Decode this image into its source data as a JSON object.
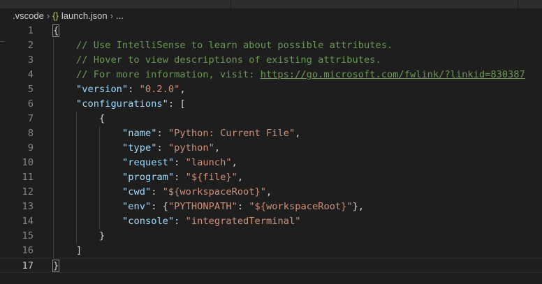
{
  "breadcrumb": {
    "folder": ".vscode",
    "file": "launch.json",
    "more": "...",
    "file_icon": "{}"
  },
  "editor": {
    "current_line": 17,
    "lines": [
      {
        "n": "1",
        "indent": 0,
        "tokens": [
          [
            "p",
            "{"
          ]
        ]
      },
      {
        "n": "2",
        "indent": 1,
        "tokens": [
          [
            "c",
            "// Use IntelliSense to learn about possible attributes."
          ]
        ]
      },
      {
        "n": "3",
        "indent": 1,
        "tokens": [
          [
            "c",
            "// Hover to view descriptions of existing attributes."
          ]
        ]
      },
      {
        "n": "4",
        "indent": 1,
        "tokens": [
          [
            "c",
            "// For more information, visit: "
          ],
          [
            "u",
            "https://go.microsoft.com/fwlink/?linkid=830387"
          ]
        ]
      },
      {
        "n": "5",
        "indent": 1,
        "tokens": [
          [
            "k",
            "\"version\""
          ],
          [
            "p",
            ": "
          ],
          [
            "s",
            "\"0.2.0\""
          ],
          [
            "p",
            ","
          ]
        ]
      },
      {
        "n": "6",
        "indent": 1,
        "tokens": [
          [
            "k",
            "\"configurations\""
          ],
          [
            "p",
            ": ["
          ]
        ]
      },
      {
        "n": "7",
        "indent": 2,
        "tokens": [
          [
            "p",
            "{"
          ]
        ]
      },
      {
        "n": "8",
        "indent": 3,
        "tokens": [
          [
            "k",
            "\"name\""
          ],
          [
            "p",
            ": "
          ],
          [
            "s",
            "\"Python: Current File\""
          ],
          [
            "p",
            ","
          ]
        ]
      },
      {
        "n": "9",
        "indent": 3,
        "tokens": [
          [
            "k",
            "\"type\""
          ],
          [
            "p",
            ": "
          ],
          [
            "s",
            "\"python\""
          ],
          [
            "p",
            ","
          ]
        ]
      },
      {
        "n": "10",
        "indent": 3,
        "tokens": [
          [
            "k",
            "\"request\""
          ],
          [
            "p",
            ": "
          ],
          [
            "s",
            "\"launch\""
          ],
          [
            "p",
            ","
          ]
        ]
      },
      {
        "n": "11",
        "indent": 3,
        "tokens": [
          [
            "k",
            "\"program\""
          ],
          [
            "p",
            ": "
          ],
          [
            "s",
            "\"${file}\""
          ],
          [
            "p",
            ","
          ]
        ]
      },
      {
        "n": "12",
        "indent": 3,
        "tokens": [
          [
            "k",
            "\"cwd\""
          ],
          [
            "p",
            ": "
          ],
          [
            "s",
            "\"${workspaceRoot}\""
          ],
          [
            "p",
            ","
          ]
        ]
      },
      {
        "n": "13",
        "indent": 3,
        "tokens": [
          [
            "k",
            "\"env\""
          ],
          [
            "p",
            ": {"
          ],
          [
            "s",
            "\"PYTHONPATH\""
          ],
          [
            "p",
            ": "
          ],
          [
            "s",
            "\"${workspaceRoot}\""
          ],
          [
            "p",
            "},"
          ]
        ]
      },
      {
        "n": "14",
        "indent": 3,
        "tokens": [
          [
            "k",
            "\"console\""
          ],
          [
            "p",
            ": "
          ],
          [
            "s",
            "\"integratedTerminal\""
          ]
        ]
      },
      {
        "n": "15",
        "indent": 2,
        "tokens": [
          [
            "p",
            "}"
          ]
        ]
      },
      {
        "n": "16",
        "indent": 1,
        "tokens": [
          [
            "p",
            "]"
          ]
        ]
      },
      {
        "n": "17",
        "indent": 0,
        "tokens": [
          [
            "p",
            "}"
          ]
        ]
      }
    ]
  }
}
